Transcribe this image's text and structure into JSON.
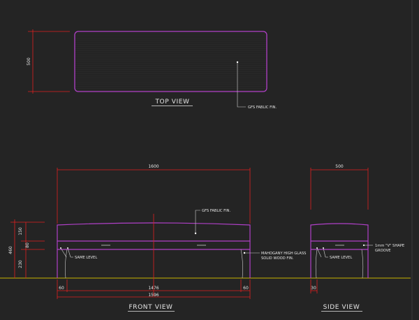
{
  "views": {
    "top": {
      "title": "TOP VIEW",
      "dim_height": "500",
      "note": "GFS FABLIC FIN."
    },
    "front": {
      "title": "FRONT VIEW",
      "dim_overall_top": "1600",
      "dim_left_offset": "60",
      "dim_middle": "1476",
      "dim_right_offset": "60",
      "dim_overall_bottom": "1596",
      "dim_total_height": "460",
      "dim_top_height": "150",
      "dim_mid_height": "80",
      "dim_bottom_height": "230",
      "note_fabric": "GFS FABLIC FIN.",
      "note_wood_line1": "MAHOGANY HIGH GLASS",
      "note_wood_line2": "SOLID WOOD FIN.",
      "note_level": "SAME LEVEL"
    },
    "side": {
      "title": "SIDE VIEW",
      "dim_width": "500",
      "dim_leg_offset": "30",
      "note_groove_line1": "1mm \"V\" SHAPE",
      "note_groove_line2": "GROOVE",
      "note_level": "SAME LEVEL"
    }
  },
  "colors": {
    "background": "#242424",
    "outline": "#b040c8",
    "dimension": "#e02020",
    "text": "#e6e6e6",
    "floor": "#c8b400",
    "leader": "#d0d0d0",
    "hatch": "#303030"
  }
}
